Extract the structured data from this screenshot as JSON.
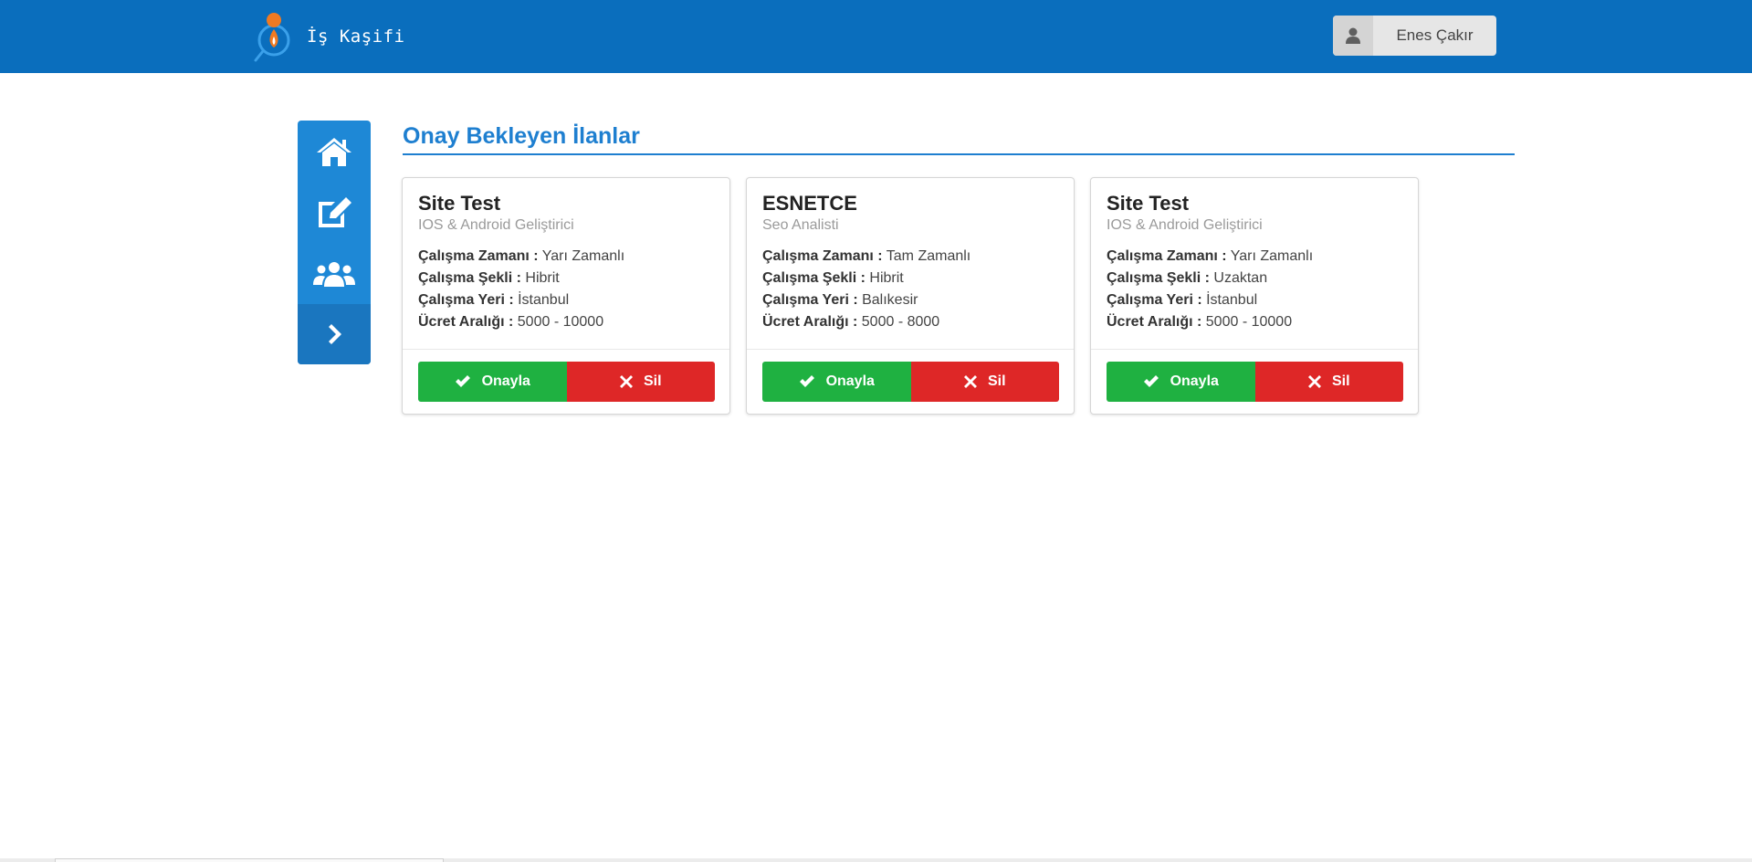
{
  "header": {
    "brand_name": "İş Kaşifi",
    "user_name": "Enes Çakır",
    "colors": {
      "bar": "#0a6ebd"
    }
  },
  "sidebar": {
    "items": [
      {
        "icon": "home-icon"
      },
      {
        "icon": "edit-icon"
      },
      {
        "icon": "users-icon"
      },
      {
        "icon": "chevron-right-icon"
      }
    ]
  },
  "main": {
    "title": "Onay Bekleyen İlanlar",
    "labels": {
      "zaman": "Çalışma Zamanı :",
      "sekil": "Çalışma Şekli :",
      "yer": "Çalışma Yeri :",
      "ucret": "Ücret Aralığı :"
    },
    "buttons": {
      "approve": "Onayla",
      "delete": "Sil"
    },
    "cards": [
      {
        "title": "Site Test",
        "subtitle": "IOS & Android Geliştirici",
        "zaman": "Yarı Zamanlı",
        "sekil": "Hibrit",
        "yer": "İstanbul",
        "ucret": "5000 - 10000"
      },
      {
        "title": "ESNETCE",
        "subtitle": "Seo Analisti",
        "zaman": "Tam Zamanlı",
        "sekil": "Hibrit",
        "yer": "Balıkesir",
        "ucret": "5000 - 8000"
      },
      {
        "title": "Site Test",
        "subtitle": "IOS & Android Geliştirici",
        "zaman": "Yarı Zamanlı",
        "sekil": "Uzaktan",
        "yer": "İstanbul",
        "ucret": "5000 - 10000"
      }
    ],
    "colors": {
      "approve": "#1fb141",
      "delete": "#de2727",
      "accent": "#1e7fd0"
    }
  }
}
